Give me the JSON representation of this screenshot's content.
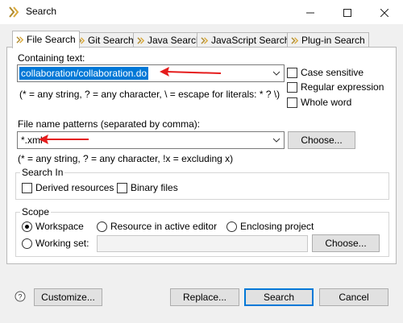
{
  "window": {
    "title": "Search"
  },
  "tabs": [
    {
      "label": "File Search",
      "active": true
    },
    {
      "label": "Git Search",
      "active": false
    },
    {
      "label": "Java Search",
      "active": false
    },
    {
      "label": "JavaScript Search",
      "active": false
    },
    {
      "label": "Plug-in Search",
      "active": false
    }
  ],
  "containing": {
    "label": "Containing text:",
    "value": "collaboration/collaboration.do",
    "hint": "(* = any string, ? = any character, \\ = escape for literals: * ? \\)"
  },
  "options": {
    "case_sensitive": "Case sensitive",
    "regular_expression": "Regular expression",
    "whole_word": "Whole word"
  },
  "file_patterns": {
    "label": "File name patterns (separated by comma):",
    "value": "*.xml",
    "hint": "(* = any string, ? = any character, !x = excluding x)",
    "choose_label": "Choose..."
  },
  "search_in": {
    "title": "Search In",
    "derived": "Derived resources",
    "binary": "Binary files"
  },
  "scope": {
    "title": "Scope",
    "workspace": "Workspace",
    "active_editor": "Resource in active editor",
    "enclosing_project": "Enclosing project",
    "working_set": "Working set:",
    "working_set_value": "",
    "choose_label": "Choose...",
    "selected": "Workspace"
  },
  "footer": {
    "customize": "Customize...",
    "replace": "Replace...",
    "search": "Search",
    "cancel": "Cancel"
  },
  "colors": {
    "selection": "#0078d7",
    "arrow": "#e51c1c"
  }
}
